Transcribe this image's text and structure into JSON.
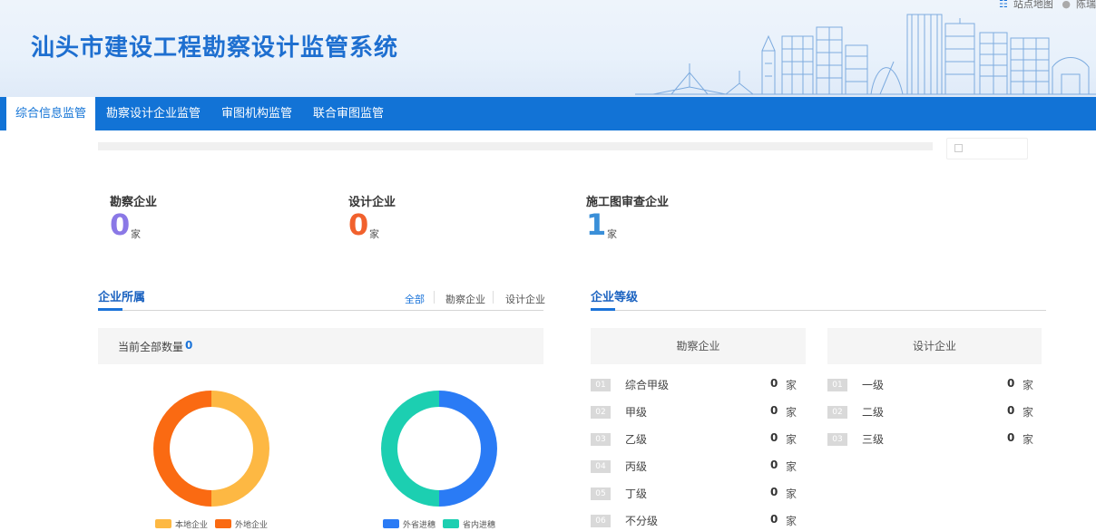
{
  "header": {
    "title": "汕头市建设工程勘察设计监管系统",
    "links": [
      "站点地图",
      "陈瑞"
    ],
    "colors": {
      "title": "#1e6fd0",
      "nav_bg": "#1273d6"
    }
  },
  "nav": {
    "items": [
      {
        "label": "综合信息监管",
        "active": true
      },
      {
        "label": "勘察设计企业监管",
        "active": false
      },
      {
        "label": "审图机构监管",
        "active": false
      },
      {
        "label": "联合审图监管",
        "active": false
      }
    ]
  },
  "stats": [
    {
      "label": "勘察企业",
      "value": "0",
      "unit": "家",
      "color": "#8a78e6"
    },
    {
      "label": "设计企业",
      "value": "0",
      "unit": "家",
      "color": "#f1612d"
    },
    {
      "label": "施工图审查企业",
      "value": "1",
      "unit": "家",
      "color": "#3a8fd8"
    }
  ],
  "affiliation": {
    "title": "企业所属",
    "filters": [
      {
        "label": "全部",
        "active": true
      },
      {
        "label": "勘察企业",
        "active": false
      },
      {
        "label": "设计企业",
        "active": false
      }
    ],
    "count_label": "当前全部数量",
    "count_value": "0"
  },
  "chart_data": [
    {
      "type": "pie",
      "categories": [
        "本地企业",
        "外地企业"
      ],
      "values": [
        1,
        1
      ],
      "colors": [
        "#fdb843",
        "#fa6a12"
      ]
    },
    {
      "type": "pie",
      "categories": [
        "外省进穗",
        "省内进穗"
      ],
      "values": [
        1,
        1
      ],
      "colors": [
        "#2a7bf5",
        "#1ccfb1"
      ]
    }
  ],
  "grades": {
    "title": "企业等级",
    "survey": {
      "heading": "勘察企业",
      "rows": [
        {
          "idx": "01",
          "name": "综合甲级",
          "value": "0",
          "unit": "家"
        },
        {
          "idx": "02",
          "name": "甲级",
          "value": "0",
          "unit": "家"
        },
        {
          "idx": "03",
          "name": "乙级",
          "value": "0",
          "unit": "家"
        },
        {
          "idx": "04",
          "name": "丙级",
          "value": "0",
          "unit": "家"
        },
        {
          "idx": "05",
          "name": "丁级",
          "value": "0",
          "unit": "家"
        },
        {
          "idx": "06",
          "name": "不分级",
          "value": "0",
          "unit": "家"
        }
      ]
    },
    "design": {
      "heading": "设计企业",
      "rows": [
        {
          "idx": "01",
          "name": "一级",
          "value": "0",
          "unit": "家"
        },
        {
          "idx": "02",
          "name": "二级",
          "value": "0",
          "unit": "家"
        },
        {
          "idx": "03",
          "name": "三级",
          "value": "0",
          "unit": "家"
        }
      ]
    }
  }
}
